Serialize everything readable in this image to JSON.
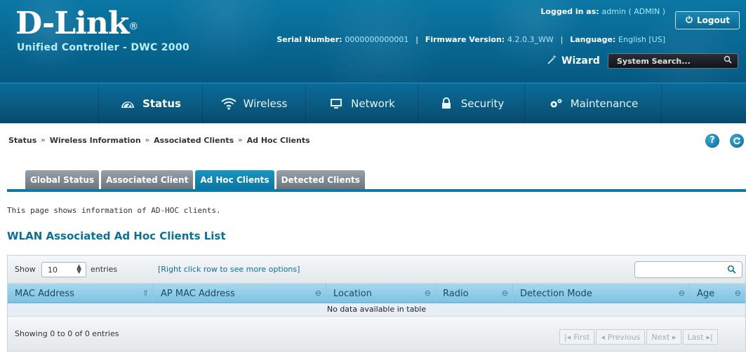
{
  "header": {
    "logo": "D-Link",
    "logo_mark": "®",
    "product": "Unified Controller - DWC 2000",
    "logged_in_label": "Logged in as:",
    "logged_in_value": "admin ( ADMIN )",
    "serial_label": "Serial Number:",
    "serial_value": "0000000000001",
    "firmware_label": "Firmware Version:",
    "firmware_value": "4.2.0.3_WW",
    "language_label": "Language:",
    "language_value": "English [US]",
    "logout_label": "Logout",
    "wizard_label": "Wizard",
    "system_search_placeholder": "System Search..."
  },
  "nav": {
    "items": [
      {
        "label": "Status",
        "icon": "dashboard-icon"
      },
      {
        "label": "Wireless",
        "icon": "wifi-icon"
      },
      {
        "label": "Network",
        "icon": "monitor-icon"
      },
      {
        "label": "Security",
        "icon": "lock-icon"
      },
      {
        "label": "Maintenance",
        "icon": "gears-icon"
      }
    ]
  },
  "breadcrumb": {
    "items": [
      "Status",
      "Wireless Information",
      "Associated Clients",
      "Ad Hoc Clients"
    ],
    "separator": "»"
  },
  "tabs": [
    {
      "label": "Global Status",
      "active": false
    },
    {
      "label": "Associated Client",
      "active": false
    },
    {
      "label": "Ad Hoc Clients",
      "active": true
    },
    {
      "label": "Detected Clients",
      "active": false
    }
  ],
  "page": {
    "description": "This page shows information of AD-HOC clients.",
    "list_title": "WLAN Associated Ad Hoc Clients List"
  },
  "table": {
    "show_label": "Show",
    "entries_value": "10",
    "entries_label": "entries",
    "right_click_hint": "[Right click row to see more options]",
    "columns": [
      "MAC Address",
      "AP MAC Address",
      "Location",
      "Radio",
      "Detection Mode",
      "Age"
    ],
    "empty_message": "No data available in table",
    "info": "Showing 0 to 0 of 0 entries",
    "pager": {
      "first": "First",
      "previous": "Previous",
      "next": "Next",
      "last": "Last"
    }
  },
  "colors": {
    "header_blue": "#076792",
    "tab_active": "#0a76a3",
    "tab_inactive": "#7f8990",
    "table_header": "#7cc2e2",
    "title_blue": "#0a6f99"
  }
}
